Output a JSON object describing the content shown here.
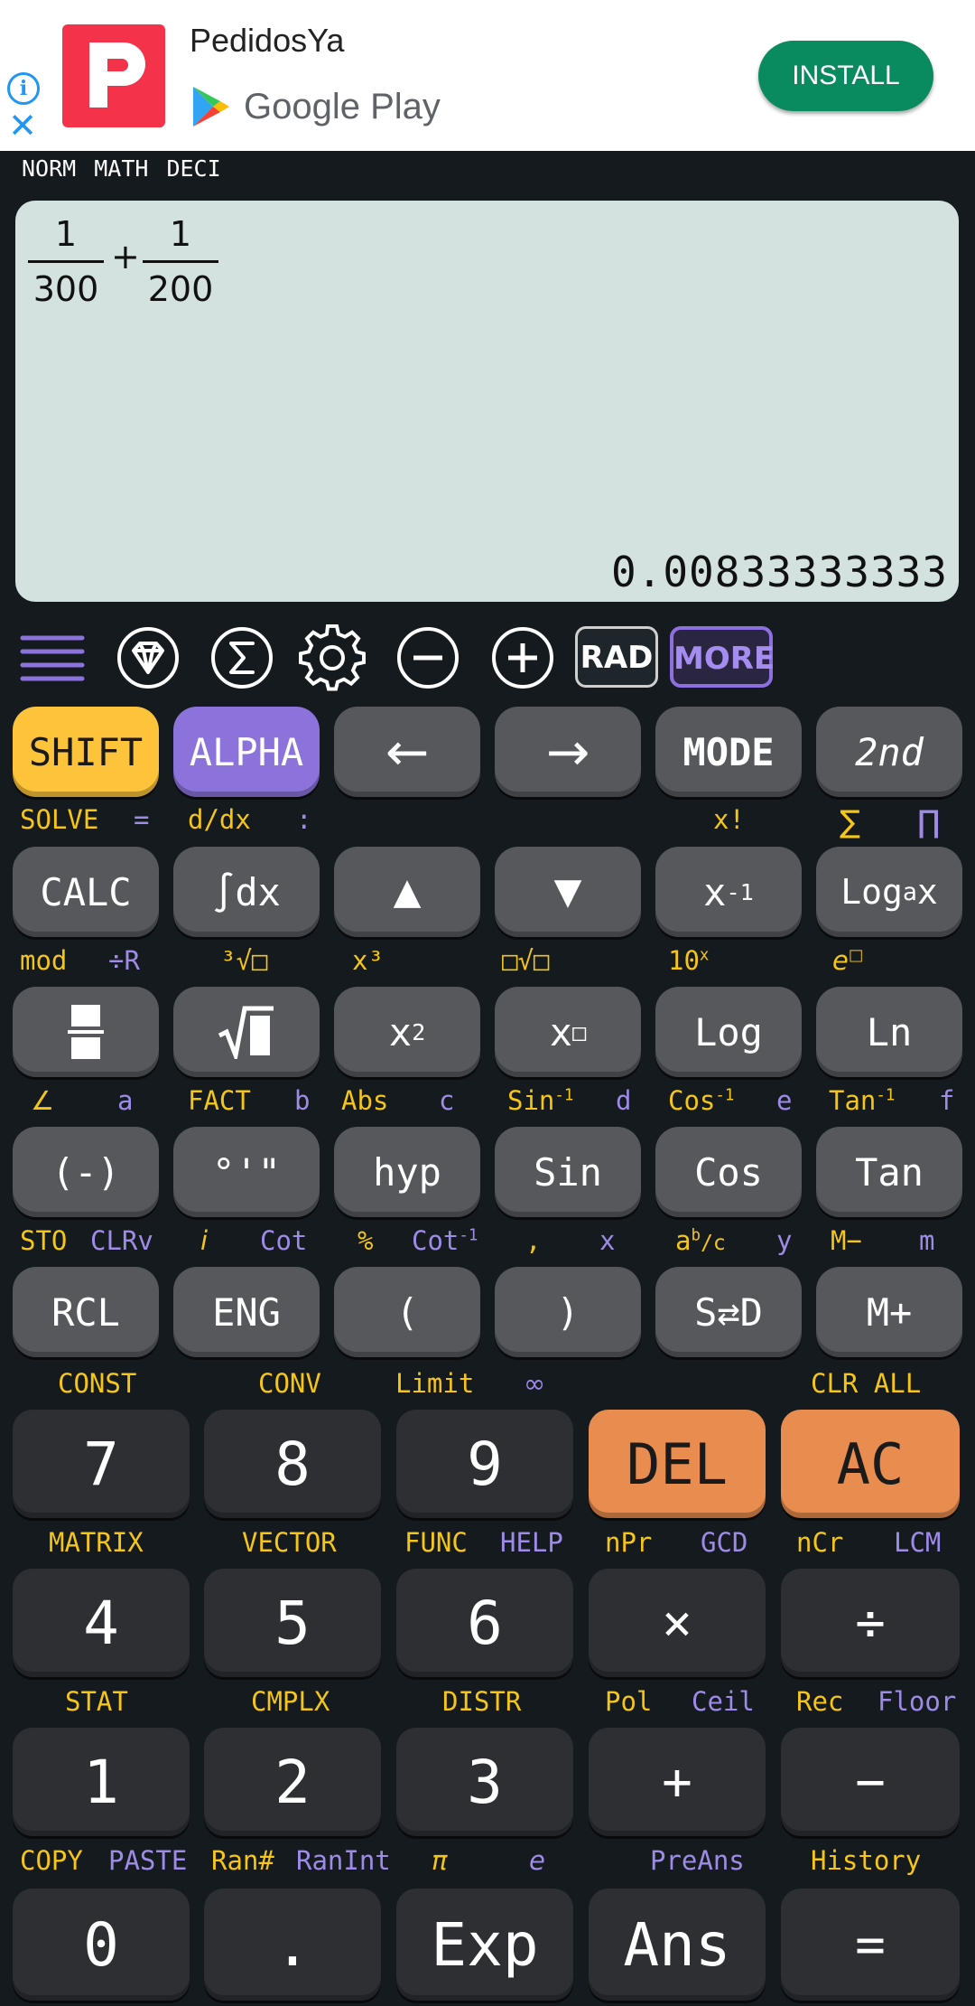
{
  "ad": {
    "title": "PedidosYa",
    "store": "Google Play",
    "install": "INSTALL",
    "info_glyph": "i",
    "close_glyph": "✕",
    "brand_color": "#f4334a",
    "button_color": "#0a8a5f"
  },
  "status": [
    "NORM",
    "MATH",
    "DECI"
  ],
  "display": {
    "expression": {
      "term1": {
        "num": "1",
        "den": "300"
      },
      "operator": "+",
      "term2": {
        "num": "1",
        "den": "200"
      }
    },
    "result": "0.00833333333"
  },
  "toolbar": {
    "icons": [
      "menu-icon",
      "gem-icon",
      "sigma-icon",
      "gear-icon",
      "minus-circle-icon",
      "plus-circle-icon"
    ],
    "rad": "RAD",
    "more": "MORE"
  },
  "rows": {
    "r1": {
      "keys": [
        "SHIFT",
        "ALPHA",
        "←",
        "→",
        "MODE",
        "2nd"
      ],
      "labels": {
        "solve": "SOLVE",
        "eq": "=",
        "ddx": "d/dx",
        "colon": ":",
        "fact": "x!",
        "sum": "∑",
        "prod": "∏"
      }
    },
    "r2": {
      "keys": [
        "CALC",
        "∫dx",
        "▲",
        "▼",
        "x",
        "Log",
        "x"
      ],
      "xinv_sup": "-1",
      "loga_sub": "a",
      "labels": {
        "mod": "mod",
        "divr": "÷R",
        "cbrt": "³√□",
        "x3": "x³",
        "xroot": "□√□",
        "tenx": "10",
        "tenx_sup": "x",
        "ex": "e",
        "ex_sup": "□"
      }
    },
    "r3": {
      "keys": [
        "fraction-icon",
        "sqrt-icon",
        "x",
        "x",
        "Log",
        "Ln"
      ],
      "x2_sup": "2",
      "xbox_sup": "□",
      "labels": {
        "angle": "∠",
        "a": "a",
        "fact": "FACT",
        "b": "b",
        "abs": "Abs",
        "c": "c",
        "sin_inv": "Sin",
        "d": "d",
        "cos_inv": "Cos",
        "e": "e",
        "tan_inv": "Tan",
        "f": "f",
        "inv_sup": "-1"
      }
    },
    "r4": {
      "keys": [
        "(-)",
        "°'\"",
        "hyp",
        "Sin",
        "Cos",
        "Tan"
      ],
      "labels": {
        "sto": "STO",
        "clrv": "CLRv",
        "i": "i",
        "cot": "Cot",
        "pct": "%",
        "cot_inv": "Cot",
        "cot_sup": "-1",
        "comma": ",",
        "x": "x",
        "abc": "a",
        "abc_sup": "b",
        "abc_end": "/c",
        "y": "y",
        "mminus": "M−",
        "m": "m"
      }
    },
    "r5": {
      "keys": [
        "RCL",
        "ENG",
        "(",
        ")",
        "S⇄D",
        "M+"
      ],
      "labels": {
        "const": "CONST",
        "conv": "CONV",
        "limit": "Limit",
        "inf": "∞",
        "clrall": "CLR ALL"
      }
    },
    "r6": {
      "keys": [
        "7",
        "8",
        "9",
        "DEL",
        "AC"
      ],
      "labels": {
        "matrix": "MATRIX",
        "vector": "VECTOR",
        "func": "FUNC",
        "help": "HELP",
        "npr": "nPr",
        "gcd": "GCD",
        "ncr": "nCr",
        "lcm": "LCM"
      }
    },
    "r7": {
      "keys": [
        "4",
        "5",
        "6",
        "×",
        "÷"
      ],
      "labels": {
        "stat": "STAT",
        "cmplx": "CMPLX",
        "distr": "DISTR",
        "pol": "Pol",
        "ceil": "Ceil",
        "rec": "Rec",
        "floor": "Floor"
      }
    },
    "r8": {
      "keys": [
        "1",
        "2",
        "3",
        "+",
        "−"
      ],
      "labels": {
        "copy": "COPY",
        "paste": "PASTE",
        "ran": "Ran#",
        "ranint": "RanInt",
        "pi": "π",
        "e": "e",
        "preans": "PreAns",
        "history": "History"
      }
    },
    "r9": {
      "keys": [
        "0",
        ".",
        "Exp",
        "Ans",
        "="
      ]
    }
  },
  "colors": {
    "shift_key": "#fdc43b",
    "alpha_key": "#8c73db",
    "delete_keys": "#e88d4f",
    "display_bg": "#d4e2df",
    "shift_label": "#f5c518",
    "alpha_label": "#9e8be8"
  }
}
